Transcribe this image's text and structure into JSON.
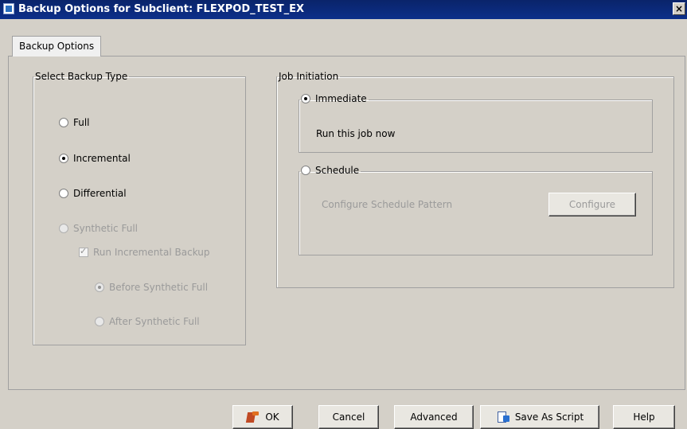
{
  "window": {
    "title": "Backup Options for Subclient: FLEXPOD_TEST_EX",
    "close_label": "×"
  },
  "tabs": [
    {
      "label": "Backup Options"
    }
  ],
  "backup_type": {
    "legend": "Select Backup Type",
    "options": {
      "full": "Full",
      "incremental": "Incremental",
      "differential": "Differential",
      "synthetic_full": "Synthetic Full",
      "run_incremental": "Run Incremental Backup",
      "before_synthetic": "Before Synthetic Full",
      "after_synthetic": "After Synthetic Full"
    },
    "selected": "incremental"
  },
  "job_initiation": {
    "legend": "Job Initiation",
    "immediate": {
      "label": "Immediate",
      "description": "Run this job now"
    },
    "schedule": {
      "label": "Schedule",
      "description": "Configure Schedule Pattern",
      "button": "Configure"
    },
    "selected": "immediate"
  },
  "buttons": {
    "ok": "OK",
    "cancel": "Cancel",
    "advanced": "Advanced",
    "save_script": "Save As Script",
    "help": "Help"
  }
}
